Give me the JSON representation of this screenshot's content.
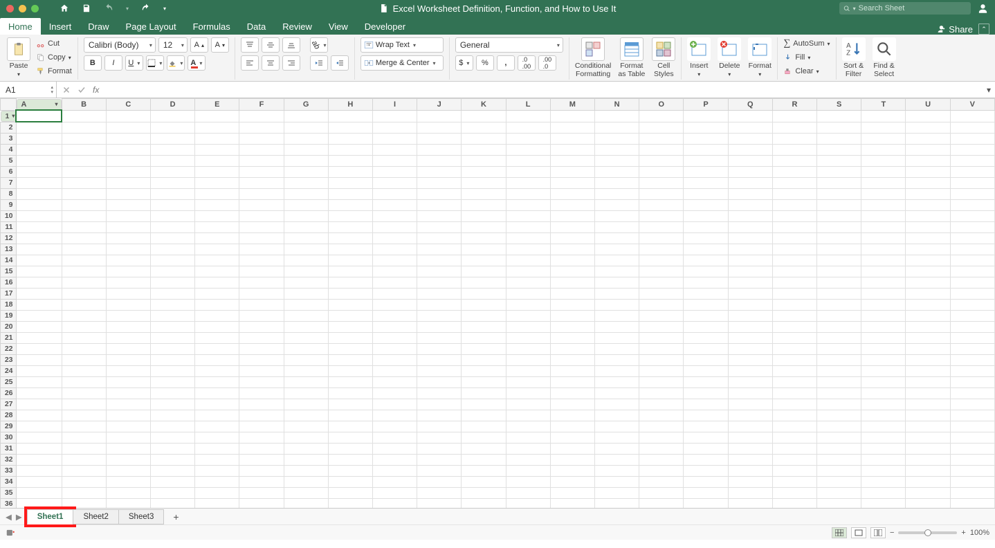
{
  "title": "Excel Worksheet Definition, Function, and How to Use It",
  "search_placeholder": "Search Sheet",
  "tabs": [
    "Home",
    "Insert",
    "Draw",
    "Page Layout",
    "Formulas",
    "Data",
    "Review",
    "View",
    "Developer"
  ],
  "active_tab": "Home",
  "share_label": "Share",
  "ribbon": {
    "paste": "Paste",
    "cut": "Cut",
    "copy": "Copy",
    "format_painter": "Format",
    "font_family": "Calibri (Body)",
    "font_size": "12",
    "wrap_text": "Wrap Text",
    "merge_center": "Merge & Center",
    "number_format": "General",
    "cond_format": "Conditional\nFormatting",
    "format_table": "Format\nas Table",
    "cell_styles": "Cell\nStyles",
    "insert": "Insert",
    "delete": "Delete",
    "format": "Format",
    "autosum": "AutoSum",
    "fill": "Fill",
    "clear": "Clear",
    "sort_filter": "Sort &\nFilter",
    "find_select": "Find &\nSelect"
  },
  "namebox": "A1",
  "fx_label": "fx",
  "columns": [
    "A",
    "B",
    "C",
    "D",
    "E",
    "F",
    "G",
    "H",
    "I",
    "J",
    "K",
    "L",
    "M",
    "N",
    "O",
    "P",
    "Q",
    "R",
    "S",
    "T",
    "U",
    "V"
  ],
  "rows": 36,
  "selected_cell": {
    "row": 1,
    "col": "A"
  },
  "sheet_tabs": [
    "Sheet1",
    "Sheet2",
    "Sheet3"
  ],
  "active_sheet": "Sheet1",
  "zoom": "100%"
}
